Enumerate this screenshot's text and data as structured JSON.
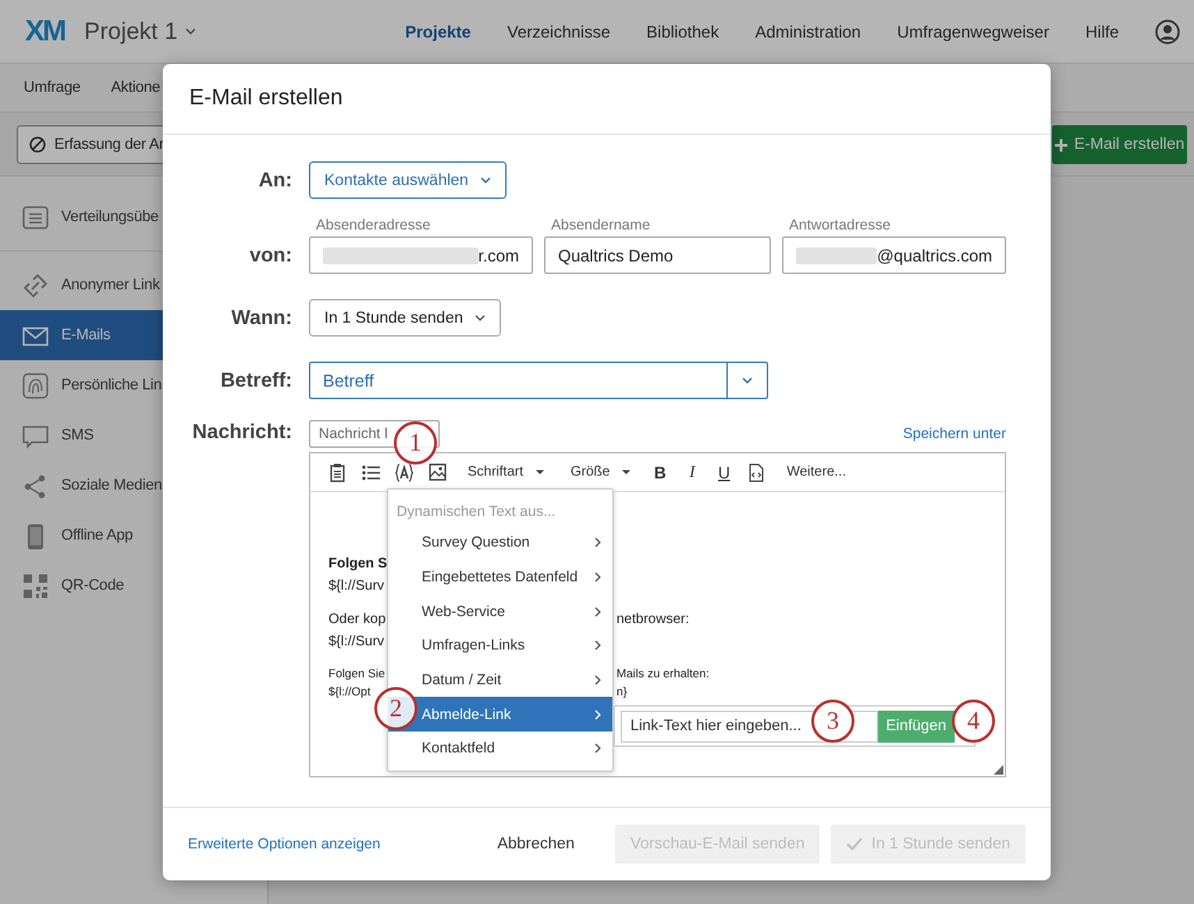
{
  "top_nav": {
    "logo": "XM",
    "project": "Projekt 1",
    "items": [
      {
        "label": "Projekte",
        "selected": true
      },
      {
        "label": "Verzeichnisse",
        "selected": false
      },
      {
        "label": "Bibliothek",
        "selected": false
      },
      {
        "label": "Administration",
        "selected": false
      },
      {
        "label": "Umfragenwegweiser",
        "selected": false
      },
      {
        "label": "Hilfe",
        "selected": false
      }
    ]
  },
  "sub_nav": {
    "tabs": [
      "Umfrage",
      "Aktione"
    ]
  },
  "action_bar": {
    "filter_button": "Erfassung der Ar",
    "create_button": "E-Mail erstellen"
  },
  "sidebar": {
    "items": [
      {
        "label": "Verteilungsübe",
        "selected": false
      },
      {
        "label": "Anonymer Link",
        "selected": false
      },
      {
        "label": "E-Mails",
        "selected": true
      },
      {
        "label": "Persönliche Lin",
        "selected": false
      },
      {
        "label": "SMS",
        "selected": false
      },
      {
        "label": "Soziale Medien",
        "selected": false
      },
      {
        "label": "Offline App",
        "selected": false
      },
      {
        "label": "QR-Code",
        "selected": false
      }
    ]
  },
  "modal": {
    "title": "E-Mail erstellen",
    "to": {
      "label": "An:",
      "value": "Kontakte auswählen"
    },
    "from": {
      "label": "von:",
      "fields": [
        {
          "caption": "Absenderadresse",
          "value": "r.com",
          "redacted": true
        },
        {
          "caption": "Absendername",
          "value": "Qualtrics Demo",
          "redacted": false
        },
        {
          "caption": "Antwortadresse",
          "value": "@qualtrics.com",
          "redacted": true
        }
      ]
    },
    "when": {
      "label": "Wann:",
      "value": "In 1 Stunde senden"
    },
    "subject": {
      "label": "Betreff:",
      "value": "Betreff"
    },
    "message": {
      "label": "Nachricht:",
      "select": "Nachricht l",
      "save_link": "Speichern unter",
      "toolbar": [
        {
          "kind": "clipboard"
        },
        {
          "kind": "list"
        },
        {
          "kind": "dyntext"
        },
        {
          "kind": "image"
        },
        {
          "kind": "dropdown",
          "label": "Schriftart"
        },
        {
          "kind": "dropdown",
          "label": "Größe"
        },
        {
          "kind": "bold",
          "label": "B"
        },
        {
          "kind": "italic",
          "label": "I"
        },
        {
          "kind": "underline",
          "label": "U"
        },
        {
          "kind": "source"
        },
        {
          "kind": "more",
          "label": "Weitere..."
        }
      ],
      "body": [
        {
          "kind": "heading",
          "left": "Folgen S"
        },
        {
          "kind": "text",
          "left": "${l://Surv"
        },
        {
          "kind": "gap"
        },
        {
          "kind": "text",
          "left": "Oder kop",
          "right": "netbrowser:"
        },
        {
          "kind": "text",
          "left": "${l://Surv"
        },
        {
          "kind": "gap"
        },
        {
          "kind": "small",
          "left": "Folgen Sie",
          "right": "Mails zu erhalten:"
        },
        {
          "kind": "small",
          "left": "${l://Opt",
          "right": "n}"
        }
      ]
    },
    "dynamic_menu": {
      "header": "Dynamischen Text aus...",
      "items": [
        {
          "label": "Survey Question",
          "selected": false
        },
        {
          "label": "Eingebettetes Datenfeld",
          "selected": false
        },
        {
          "label": "Web-Service",
          "selected": false
        },
        {
          "label": "Umfragen-Links",
          "selected": false
        },
        {
          "label": "Datum / Zeit",
          "selected": false
        },
        {
          "label": "Abmelde-Link",
          "selected": true
        },
        {
          "label": "Kontaktfeld",
          "selected": false
        }
      ]
    },
    "link_popup": {
      "placeholder": "Link-Text hier eingeben...",
      "button": "Einfügen"
    },
    "footer": {
      "advanced_link": "Erweiterte Optionen anzeigen",
      "buttons": [
        {
          "label": "Abbrechen",
          "kind": "plain",
          "disabled": false
        },
        {
          "label": "Vorschau-E-Mail senden",
          "kind": "filled",
          "disabled": true
        },
        {
          "label": "In 1 Stunde senden",
          "kind": "confirm",
          "disabled": true
        }
      ]
    }
  },
  "annotations": [
    "1",
    "2",
    "3",
    "4"
  ]
}
